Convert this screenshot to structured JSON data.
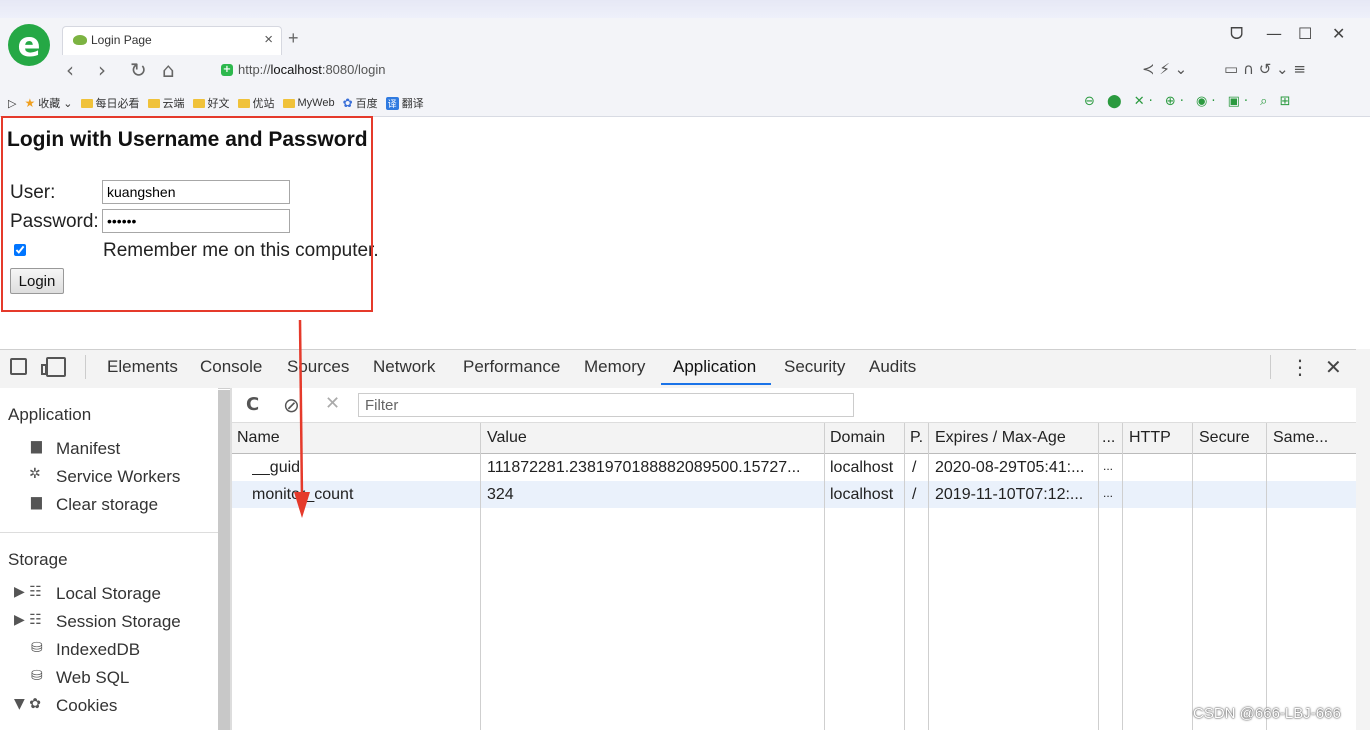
{
  "browser": {
    "tab_title": "Login Page",
    "tab_close": "×",
    "new_tab": "+",
    "window_controls": [
      "ᗜ",
      "—",
      "☐",
      "✕"
    ],
    "nav": [
      "‹",
      "›",
      "↻",
      "⌂"
    ],
    "address_prefix": "http://",
    "address_host": "localhost",
    "address_rest": ":8080/login",
    "right_tools": [
      "≺ ⚡ ⌄",
      "▭ ∩ ↺ ⌄ ≡"
    ],
    "bookmarks_toggle": "▷",
    "bookmarks": [
      {
        "label": "收藏 ⌄",
        "icon": "star-icon"
      },
      {
        "label": "每日必看",
        "icon": "folder-icon"
      },
      {
        "label": "云端",
        "icon": "folder-icon"
      },
      {
        "label": "好文",
        "icon": "folder-icon"
      },
      {
        "label": "优站",
        "icon": "folder-icon"
      },
      {
        "label": "MyWeb",
        "icon": "folder-icon"
      },
      {
        "label": "百度",
        "icon": "paw-icon"
      },
      {
        "label": "翻译",
        "icon": "translate-icon"
      }
    ],
    "extensions_text": "⊖ ⬤ ✕· ⊕· ◉· ▣· ⌕ ⊞"
  },
  "login": {
    "title": "Login with Username and Password",
    "user_label": "User:",
    "user_value": "kuangshen",
    "password_label": "Password:",
    "password_value": "••••••",
    "remember_label": "Remember me on this computer.",
    "remember_checked": true,
    "button_label": "Login"
  },
  "devtools": {
    "tabs": [
      "Elements",
      "Console",
      "Sources",
      "Network",
      "Performance",
      "Memory",
      "Application",
      "Security",
      "Audits"
    ],
    "active_tab": "Application",
    "more": "⋮",
    "close": "✕",
    "sidebar": {
      "application_header": "Application",
      "application_items": [
        {
          "label": "Manifest",
          "icon": "▆"
        },
        {
          "label": "Service Workers",
          "icon": "✲"
        },
        {
          "label": "Clear storage",
          "icon": "▆"
        }
      ],
      "storage_header": "Storage",
      "storage_items": [
        {
          "label": "Local Storage",
          "icon": "▶ ☷"
        },
        {
          "label": "Session Storage",
          "icon": "▶ ☷"
        },
        {
          "label": "IndexedDB",
          "icon": "⛁"
        },
        {
          "label": "Web SQL",
          "icon": "⛁"
        },
        {
          "label": "Cookies",
          "icon": "▼ ✿"
        }
      ]
    },
    "cookies": {
      "toolbar_icons": [
        "C",
        "⊘",
        "✕"
      ],
      "filter_placeholder": "Filter",
      "columns": [
        "Name",
        "Value",
        "Domain",
        "P.",
        "Expires / Max-Age",
        "...",
        "HTTP",
        "Secure",
        "Same..."
      ],
      "rows": [
        [
          "__guid",
          "111872281.2381970188882089500.15727...",
          "localhost",
          "/",
          "2020-08-29T05:41:...",
          "..."
        ],
        [
          "monitor_count",
          "324",
          "localhost",
          "/",
          "2019-11-10T07:12:...",
          "..."
        ]
      ]
    }
  },
  "colors": {
    "highlight": "#e53a2b",
    "active_tab_underline": "#1a73e8",
    "logo": "#25a845"
  },
  "watermark": "CSDN @666-LBJ-666"
}
